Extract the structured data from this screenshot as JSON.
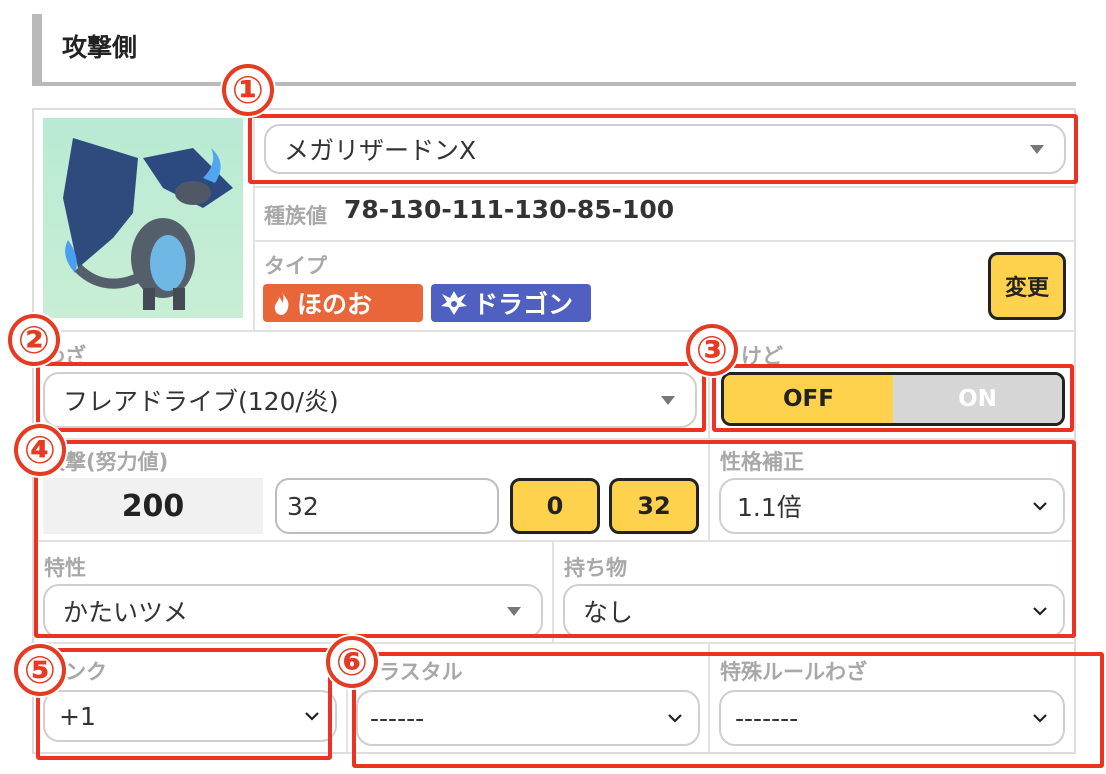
{
  "heading": {
    "title": "攻撃側"
  },
  "pokemon": {
    "name_select": "メガリザードンX",
    "stats_label": "種族値",
    "stats_value": "78-130-111-130-85-100",
    "type_label": "タイプ",
    "types": [
      {
        "label": "ほのお",
        "color": "#e8663a"
      },
      {
        "label": "ドラゴン",
        "color": "#5060c0"
      }
    ],
    "change_button": "変更"
  },
  "move": {
    "label": "わざ",
    "value": "フレアドライブ(120/炎)"
  },
  "burn": {
    "label": "やけど",
    "off_label": "OFF",
    "on_label": "ON",
    "selected": "OFF"
  },
  "attack": {
    "label": "攻撃(努力値)",
    "stat_value": "200",
    "ev_input": "32",
    "btn_0": "0",
    "btn_32": "32"
  },
  "nature": {
    "label": "性格補正",
    "value": "1.1倍"
  },
  "ability": {
    "label": "特性",
    "value": "かたいツメ"
  },
  "item": {
    "label": "持ち物",
    "value": "なし"
  },
  "rank": {
    "label": "ランク",
    "value": "+1"
  },
  "terastal": {
    "label": "テラスタル",
    "value": "------"
  },
  "special_move": {
    "label": "特殊ルールわざ",
    "value": "-------"
  },
  "annotations": [
    "①",
    "②",
    "③",
    "④",
    "⑤",
    "⑥"
  ],
  "colors": {
    "accent_red": "#ea3323",
    "button_yellow": "#ffd24d",
    "fire": "#e8663a",
    "dragon": "#5060c0"
  }
}
